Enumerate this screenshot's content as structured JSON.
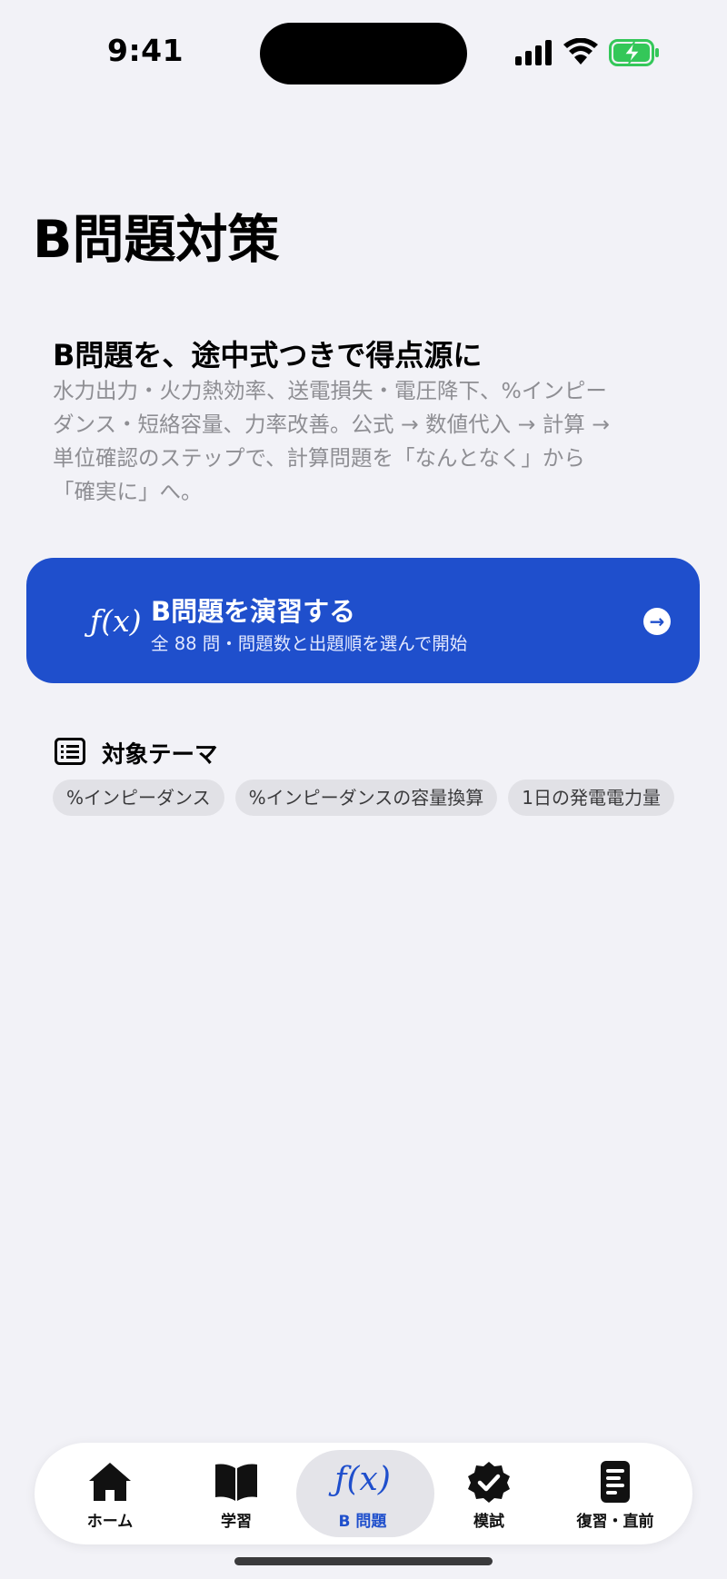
{
  "status_bar": {
    "time": "9:41",
    "icons": [
      "cellular-signal-icon",
      "wifi-icon",
      "battery-charging-icon"
    ],
    "battery_color": "#34c759"
  },
  "page_title": "B問題対策",
  "hero": {
    "title": "B問題を、途中式つきで得点源に",
    "description": "水力出力・火力熱効率、送電損失・電圧降下、%インピー\nダンス・短絡容量、力率改善。公式 → 数値代入 → 計算 →\n単位確認のステップで、計算問題を「なんとなく」から\n「確実に」へ。"
  },
  "cta": {
    "icon_text": "ƒ(x)",
    "title": "B問題を演習する",
    "subtitle": "全 88 問・問題数と出題順を選んで開始",
    "arrow": "→",
    "color": "#1f4fcc"
  },
  "themes": {
    "title": "対象テーマ",
    "chips": [
      "%インピーダンス",
      "%インピーダンスの容量換算",
      "1日の発電電力量"
    ]
  },
  "tabbar": {
    "tabs": [
      {
        "label": "ホーム",
        "icon": "house-icon"
      },
      {
        "label": "学習",
        "icon": "book-icon"
      },
      {
        "label": "B 問題",
        "icon": "fx-icon",
        "icon_text": "ƒ(x)",
        "active": true
      },
      {
        "label": "模試",
        "icon": "checkmark-seal-icon"
      },
      {
        "label": "復習・直前",
        "icon": "document-icon"
      }
    ],
    "active_color": "#1f4fcc"
  }
}
